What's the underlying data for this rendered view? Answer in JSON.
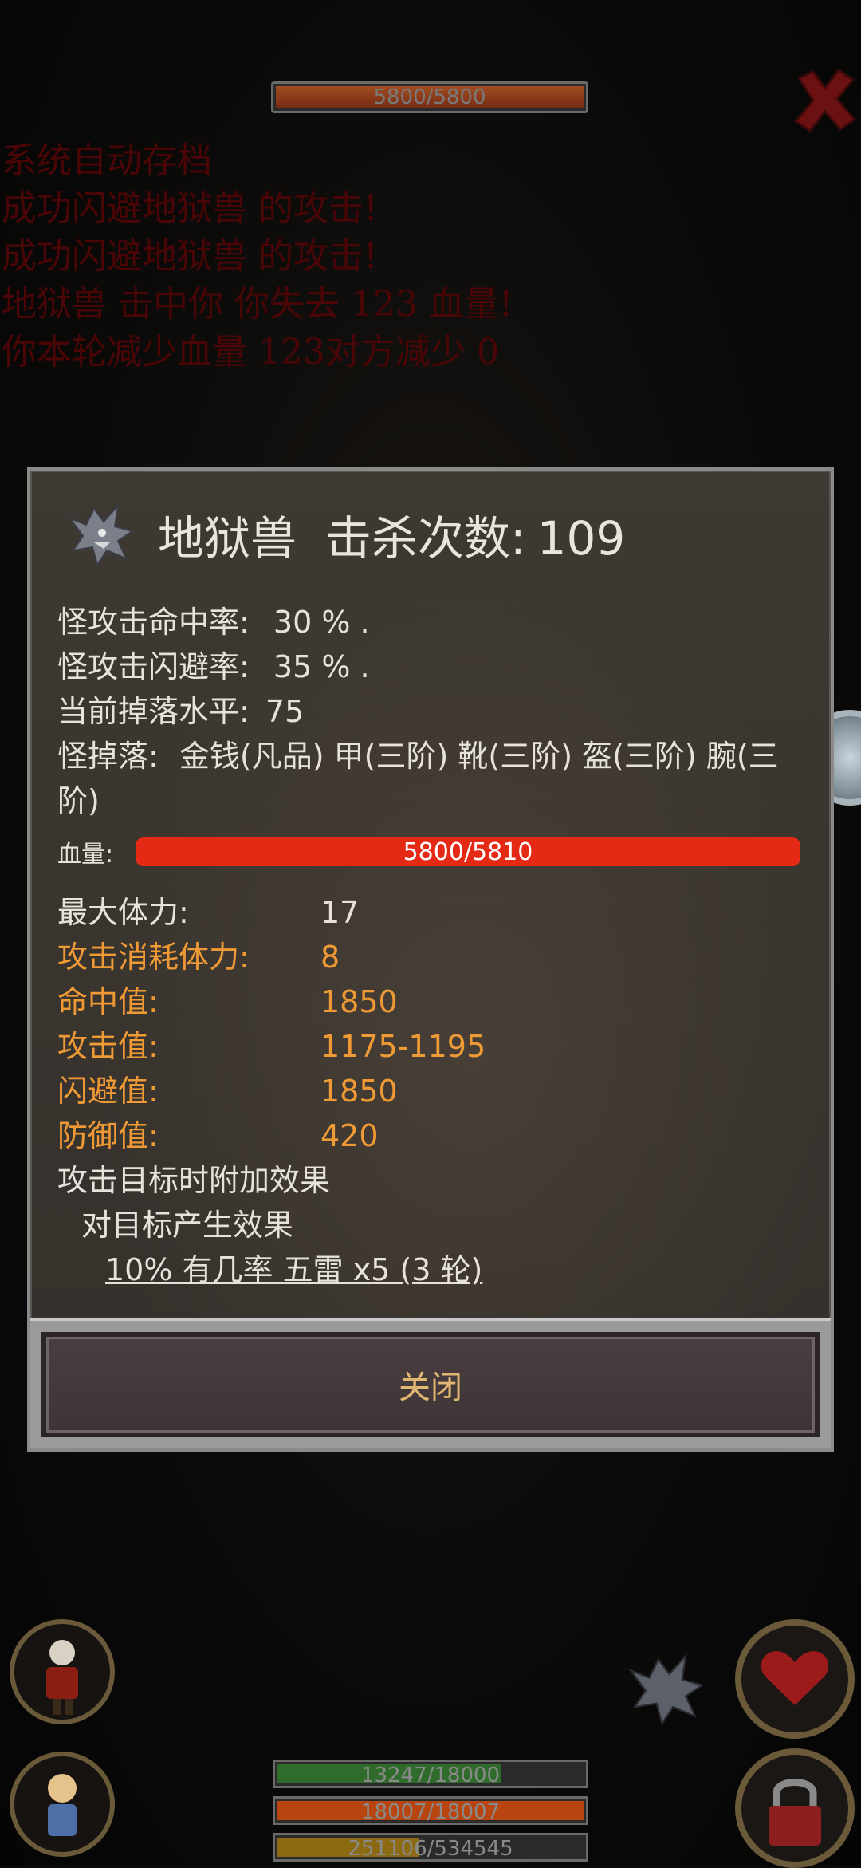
{
  "top": {
    "enemy_hp": "5800/5800"
  },
  "log": {
    "lines": [
      "系统自动存档",
      "成功闪避地狱兽  的攻击!",
      "成功闪避地狱兽  的攻击!",
      "地狱兽  击中你      你失去  123  血量!",
      "你本轮减少血量   123对方减少    0"
    ]
  },
  "modal": {
    "monster_name": "地狱兽",
    "kills_label": "击杀次数:",
    "kills_value": "109",
    "hit_rate_label": "怪攻击命中率:",
    "hit_rate_value": "30 % .",
    "dodge_rate_label": "怪攻击闪避率:",
    "dodge_rate_value": "35 % .",
    "drop_level_label": "当前掉落水平:",
    "drop_level_value": "75",
    "drops_label": "怪掉落:",
    "drops_items": "金钱(凡品) 甲(三阶) 靴(三阶) 盔(三阶) 腕(三阶)",
    "hp_label": "血量:",
    "hp_value": "5800/5810",
    "hp_fraction": 0.998,
    "stats": [
      {
        "label": "最大体力:",
        "value": "17",
        "highlight": false
      },
      {
        "label": "攻击消耗体力:",
        "value": "8",
        "highlight": true
      },
      {
        "label": "命中值:",
        "value": "1850",
        "highlight": true
      },
      {
        "label": "攻击值:",
        "value": "1175-1195",
        "highlight": true
      },
      {
        "label": "闪避值:",
        "value": "1850",
        "highlight": true
      },
      {
        "label": "防御值:",
        "value": "420",
        "highlight": true
      }
    ],
    "effect_header": "攻击目标时附加效果",
    "effect_sub": "对目标产生效果",
    "effect_detail": "10% 有几率 五雷 x5 (3 轮)",
    "close_label": "关闭"
  },
  "bottom": {
    "bar1": "13247/18000",
    "bar1_fraction": 0.736,
    "bar2": "18007/18007",
    "bar2_fraction": 1.0,
    "bar3": "251106/534545",
    "bar3_fraction": 0.47
  },
  "colors": {
    "orange": "#f09a36",
    "hp_red": "#e42a14",
    "close_text": "#e0b672"
  }
}
